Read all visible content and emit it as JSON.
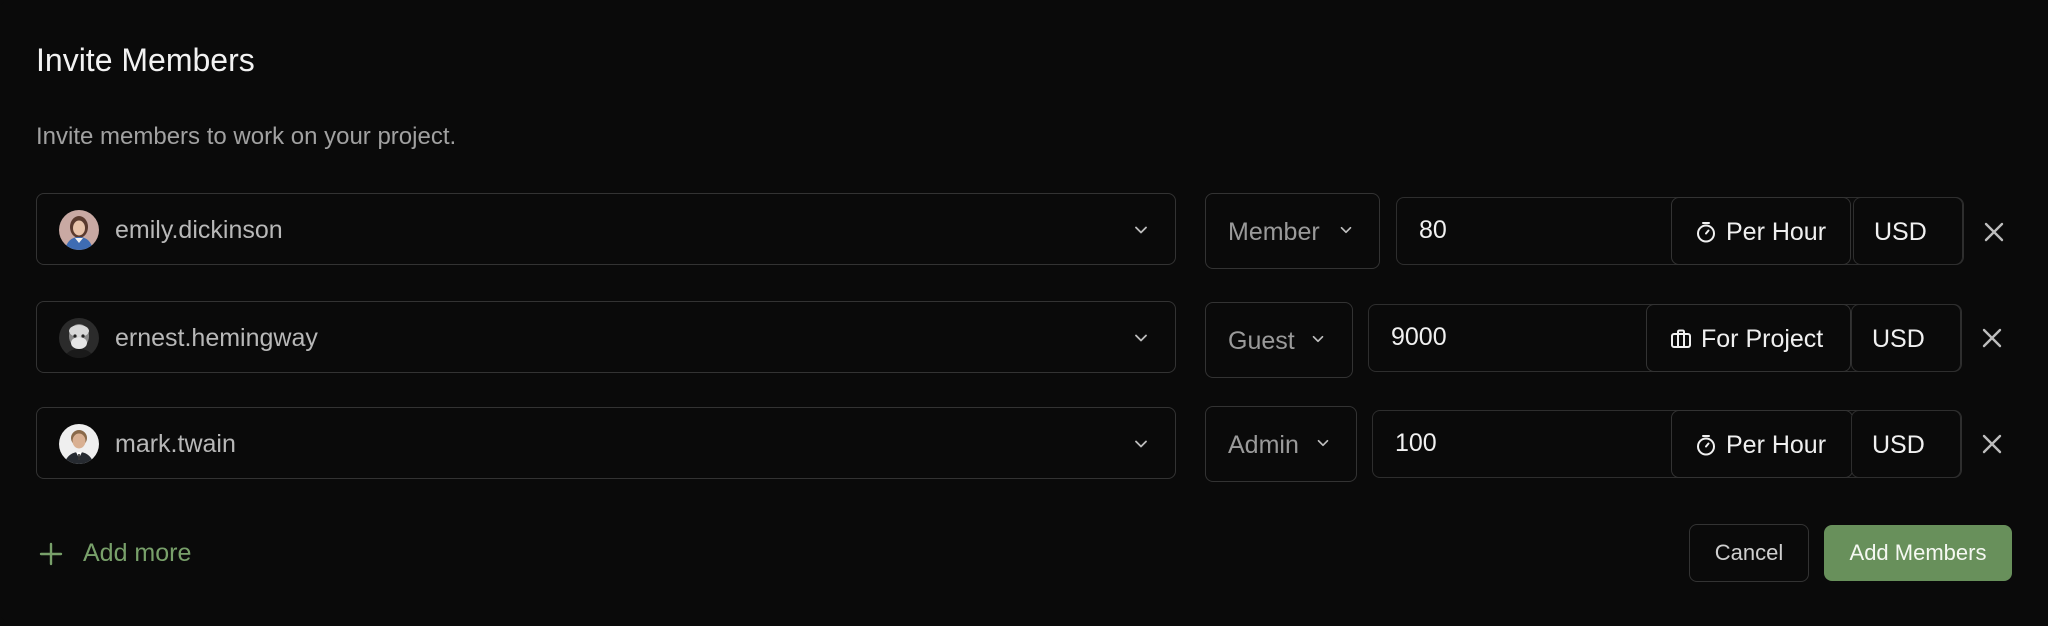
{
  "dialog": {
    "title": "Invite Members",
    "description": "Invite members to work on your project."
  },
  "members": [
    {
      "username": "emily.dickinson",
      "avatar": "avatar-emily",
      "role": "Member",
      "amount": "80",
      "rate_type": "Per Hour",
      "rate_icon": "stopwatch-icon",
      "currency": "USD"
    },
    {
      "username": "ernest.hemingway",
      "avatar": "avatar-ernest",
      "role": "Guest",
      "amount": "9000",
      "rate_type": "For Project",
      "rate_icon": "briefcase-icon",
      "currency": "USD"
    },
    {
      "username": "mark.twain",
      "avatar": "avatar-mark",
      "role": "Admin",
      "amount": "100",
      "rate_type": "Per Hour",
      "rate_icon": "stopwatch-icon",
      "currency": "USD"
    }
  ],
  "actions": {
    "add_more": "Add more",
    "cancel": "Cancel",
    "submit": "Add Members"
  },
  "colors": {
    "background": "#0a0a0a",
    "border": "#333333",
    "accent": "#68905b",
    "accent_text": "#78a06a",
    "muted_text": "#a1a1a1"
  }
}
